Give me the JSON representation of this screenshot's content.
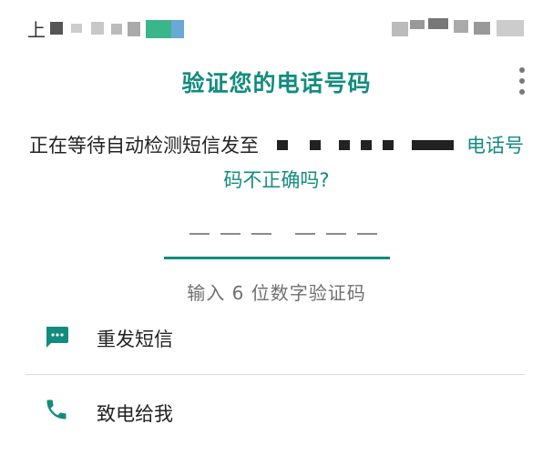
{
  "status_bar": {
    "time": "上"
  },
  "header": {
    "title": "验证您的电话号码"
  },
  "description": {
    "text": "正在等待自动检测短信发至",
    "link_part1": "电话号",
    "link_part2": "码不正确吗?"
  },
  "code_input": {
    "helper": "输入 6 位数字验证码"
  },
  "options": [
    {
      "label": "重发短信",
      "icon": "message-icon"
    },
    {
      "label": "致电给我",
      "icon": "phone-icon"
    }
  ],
  "colors": {
    "accent": "#128C7E",
    "text": "#222222",
    "muted": "#6f6f6f"
  }
}
